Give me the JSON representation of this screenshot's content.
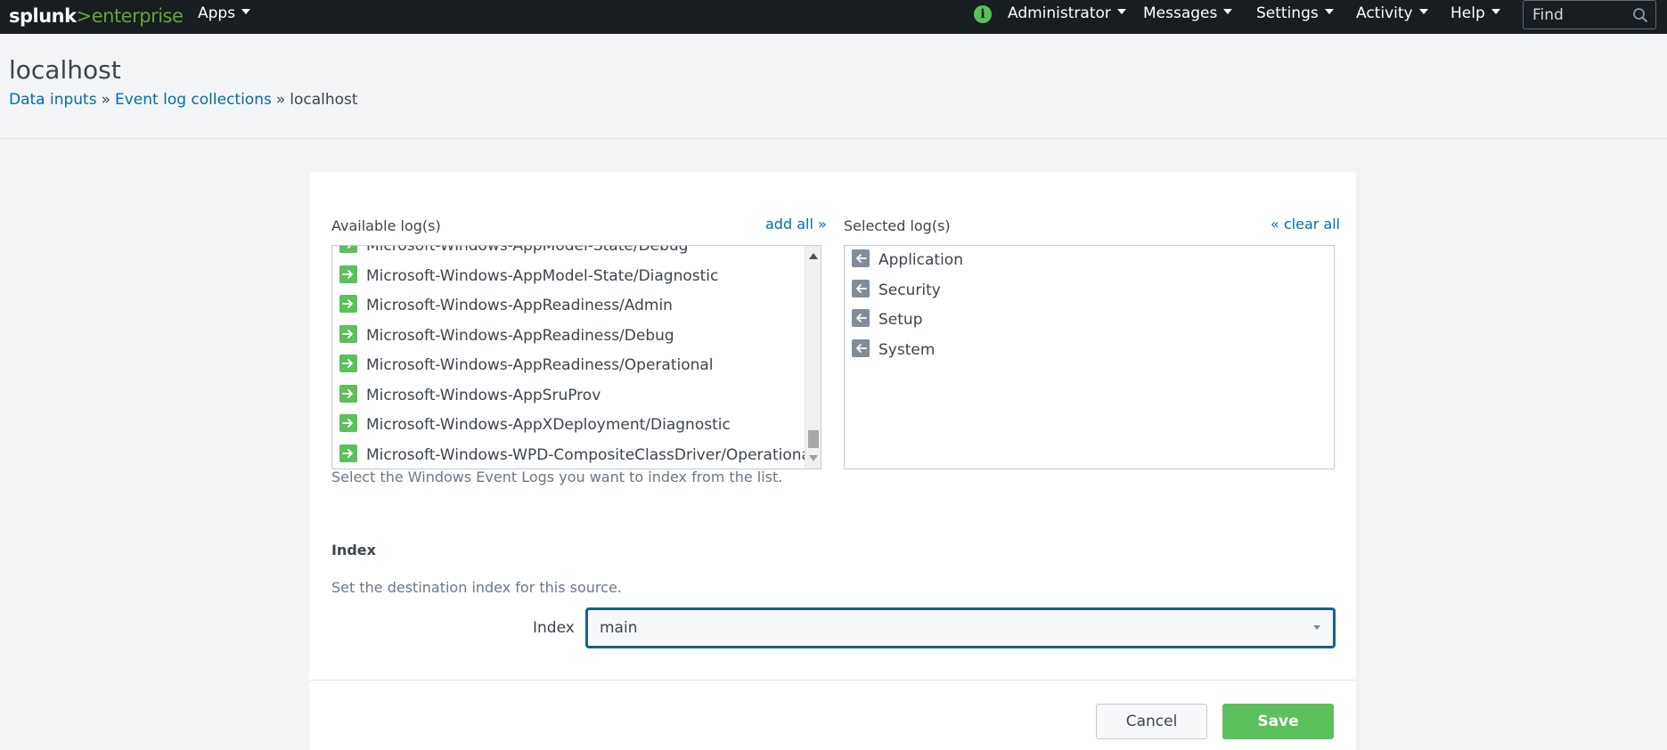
{
  "topbar": {
    "logo_brand": "splunk",
    "logo_chevron": ">",
    "logo_product": "enterprise",
    "apps": "Apps",
    "user": "Administrator",
    "messages": "Messages",
    "settings": "Settings",
    "activity": "Activity",
    "help": "Help",
    "find_placeholder": "Find",
    "info_icon": "i",
    "colors": {
      "bar": "#171d21",
      "brand_green": "#65a637",
      "status": "#5cc05c"
    }
  },
  "header": {
    "title": "localhost",
    "breadcrumb": [
      {
        "label": "Data inputs"
      },
      {
        "label": "Event log collections"
      }
    ],
    "breadcrumb_sep": "»",
    "breadcrumb_current": "localhost"
  },
  "logs": {
    "available_label": "Available log(s)",
    "add_all": "add all »",
    "selected_label": "Selected log(s)",
    "clear_all": "« clear all",
    "available": [
      "Microsoft-Windows-AppModel-State/Debug",
      "Microsoft-Windows-AppModel-State/Diagnostic",
      "Microsoft-Windows-AppReadiness/Admin",
      "Microsoft-Windows-AppReadiness/Debug",
      "Microsoft-Windows-AppReadiness/Operational",
      "Microsoft-Windows-AppSruProv",
      "Microsoft-Windows-AppXDeployment/Diagnostic",
      "Microsoft-Windows-WPD-CompositeClassDriver/Operational"
    ],
    "selected": [
      "Application",
      "Security",
      "Setup",
      "System"
    ],
    "help": "Select the Windows Event Logs you want to index from the list.",
    "add_icon": "arrow-right-icon",
    "remove_icon": "arrow-left-icon"
  },
  "index": {
    "section_title": "Index",
    "help": "Set the destination index for this source.",
    "field_label": "Index",
    "value": "main"
  },
  "actions": {
    "cancel": "Cancel",
    "save": "Save",
    "save_color": "#5cc05c"
  }
}
